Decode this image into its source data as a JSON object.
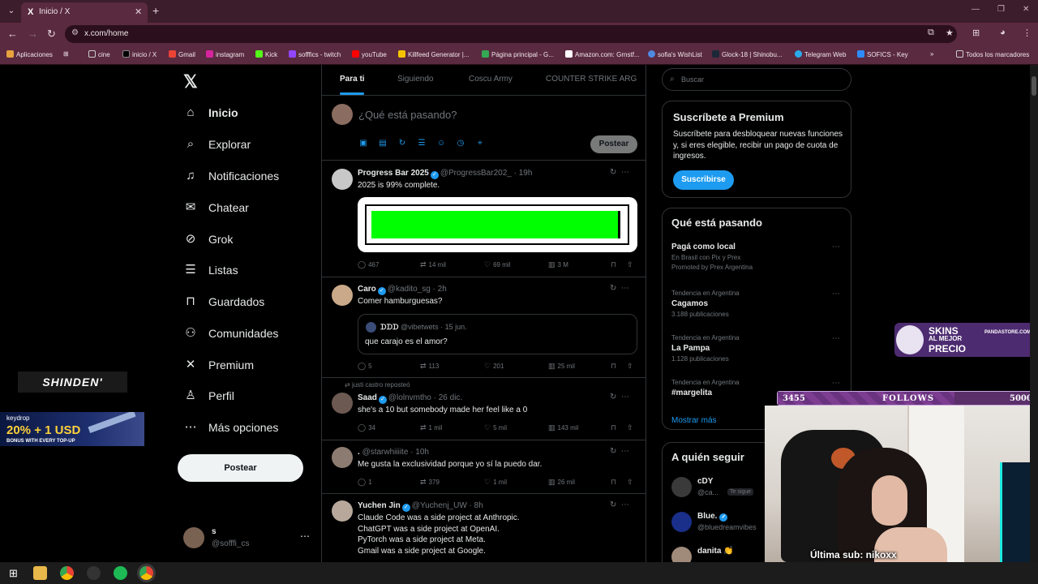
{
  "browser": {
    "tab_title": "Inicio / X",
    "url": "x.com/home",
    "bookmarks": [
      "Aplicaciones",
      "cine",
      "inicio / X",
      "Gmail",
      "instagram",
      "Kick",
      "sofffics - twitch",
      "youTube",
      "Killfeed Generator |...",
      "Página principal - G...",
      "Amazon.com: Grnstf...",
      "sofia's WishList",
      "Glock-18 | Shinobu...",
      "Telegram Web",
      "SOFICS - Key",
      "Todos los marcadores"
    ]
  },
  "nav": {
    "items": [
      {
        "label": "Inicio",
        "icon": "home-icon"
      },
      {
        "label": "Explorar",
        "icon": "search-icon"
      },
      {
        "label": "Notificaciones",
        "icon": "bell-icon"
      },
      {
        "label": "Chatear",
        "icon": "mail-icon"
      },
      {
        "label": "Grok",
        "icon": "grok-icon"
      },
      {
        "label": "Listas",
        "icon": "list-icon"
      },
      {
        "label": "Guardados",
        "icon": "bookmark-icon"
      },
      {
        "label": "Comunidades",
        "icon": "people-icon"
      },
      {
        "label": "Premium",
        "icon": "x-icon"
      },
      {
        "label": "Perfil",
        "icon": "person-icon"
      },
      {
        "label": "Más opciones",
        "icon": "more-icon"
      }
    ],
    "post_button": "Postear",
    "profile": {
      "name": "s",
      "handle": "@sofffi_cs"
    }
  },
  "ads": {
    "shinden": "SHINDEN'",
    "keydrop_brand": "keydrop",
    "keydrop_offer": "20% + 1 USD",
    "keydrop_note": "BONUS WITH EVERY TOP-UP"
  },
  "feed": {
    "tabs": [
      "Para ti",
      "Siguiendo",
      "Coscu Army",
      "COUNTER STRIKE ARG"
    ],
    "composer_placeholder": "¿Qué está pasando?",
    "composer_post": "Postear",
    "tweets": [
      {
        "name": "Progress Bar 2025",
        "handle": "@ProgressBar202_ · 19h",
        "text": "2025 is 99% complete.",
        "progress": 0.99,
        "replies": "467",
        "reposts": "14 mil",
        "likes": "69 mil",
        "views": "3 M"
      },
      {
        "name": "Caro",
        "handle": "@kadito_sg · 2h",
        "text": "Comer hamburguesas?",
        "quote_name": "ᗪᗪᗪ",
        "quote_handle": "@vibetwets · 15 jun.",
        "quote_text": "que carajo es el amor?",
        "replies": "5",
        "reposts": "113",
        "likes": "201",
        "views": "25 mil"
      },
      {
        "repost_note": "justi castro reposteó",
        "name": "Saad",
        "handle": "@lolnvmtho · 26 dic.",
        "text": "she's a 10 but somebody made her feel like a 0",
        "replies": "34",
        "reposts": "1 mil",
        "likes": "5 mil",
        "views": "143 mil"
      },
      {
        "name": ".",
        "handle": "@starwhiiiite · 10h",
        "text": "Me gusta la exclusividad porque yo sí la puedo dar.",
        "replies": "1",
        "reposts": "379",
        "likes": "1 mil",
        "views": "26 mil"
      },
      {
        "name": "Yuchen Jin",
        "handle": "@Yuchenj_UW · 8h",
        "text": "Claude Code was a side project at Anthropic.\nChatGPT was a side project at OpenAI.\nPyTorch was a side project at Meta.\nGmail was a side project at Google."
      }
    ]
  },
  "sidebar": {
    "search_placeholder": "Buscar",
    "premium": {
      "title": "Suscríbete a Premium",
      "desc": "Suscríbete para desbloquear nuevas funciones y, si eres elegible, recibir un pago de cuota de ingresos.",
      "button": "Suscribirse"
    },
    "trends_title": "Qué está pasando",
    "trends": [
      {
        "meta": "",
        "name": "Pagá como local",
        "sub": "En Brasil con Pix y Prex",
        "sub2": "Promoted by Prex Argentina"
      },
      {
        "meta": "Tendencia en Argentina",
        "name": "Cagamos",
        "sub": "3.188 publicaciones",
        "sub2": ""
      },
      {
        "meta": "Tendencia en Argentina",
        "name": "La Pampa",
        "sub": "1.128 publicaciones",
        "sub2": ""
      },
      {
        "meta": "Tendencia en Argentina",
        "name": "#margelita",
        "sub": "",
        "sub2": ""
      }
    ],
    "show_more": "Mostrar más",
    "follow_title": "A quién seguir",
    "follows": [
      {
        "name": "cDY",
        "handle": "@ca...",
        "badge": "Te sigue"
      },
      {
        "name": "Blue.",
        "handle": "@bluedreamvibes",
        "badge": ""
      },
      {
        "name": "danita 👏",
        "handle": "",
        "badge": ""
      }
    ]
  },
  "overlay": {
    "skins_l1": "SKINS",
    "skins_l2": "AL MEJOR",
    "skins_l3": "PRECIO",
    "skins_site": "PANDASTORE.COM",
    "follows_current": "3455",
    "follows_label": "FOLLOWS",
    "follows_goal": "5000",
    "follows_progress": 0.691,
    "last_sub": "Última sub: nikoxx"
  }
}
